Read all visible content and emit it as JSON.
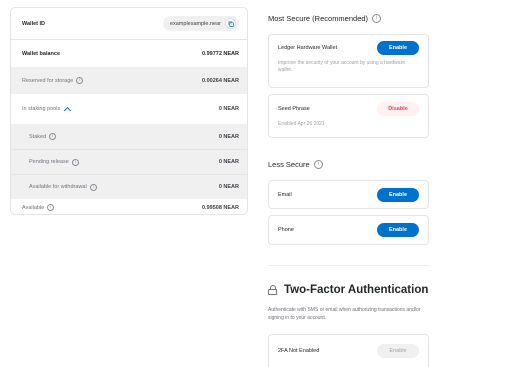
{
  "wallet": {
    "id_label": "Wallet ID",
    "id_value": "examplesample.near",
    "balance_label": "Wallet balance",
    "balance_value": "0.99772 NEAR",
    "reserved_label": "Reserved for storage",
    "reserved_value": "0.00264 NEAR",
    "staking_label": "In staking pools",
    "staking_value": "0 NEAR",
    "staked_label": "Staked",
    "staked_value": "0 NEAR",
    "pending_label": "Pending release",
    "pending_value": "0 NEAR",
    "withdraw_label": "Available for withdrawal",
    "withdraw_value": "0 NEAR",
    "available_label": "Available",
    "available_value": "0.99508 NEAR"
  },
  "most_secure": {
    "title": "Most Secure (Recommended)",
    "ledger": {
      "name": "Ledger Hardware Wallet",
      "button": "Enable",
      "description": "Improve the security of your account by using a hardware wallet."
    },
    "seed": {
      "name": "Seed Phrase",
      "button": "Disable",
      "status": "Enabled Apr 26 2021"
    }
  },
  "less_secure": {
    "title": "Less Secure",
    "email": {
      "name": "Email",
      "button": "Enable"
    },
    "phone": {
      "name": "Phone",
      "button": "Enable"
    }
  },
  "two_factor": {
    "title": "Two-Factor Authentication",
    "description": "Authenticate with SMS or email when authorizing transactions and/or signing in to your account.",
    "status": "2FA Not Enabled",
    "button": "Enable"
  },
  "colors": {
    "accent": "#0072ce",
    "danger": "#e5484d",
    "muted_bg": "#f0f0f1"
  }
}
